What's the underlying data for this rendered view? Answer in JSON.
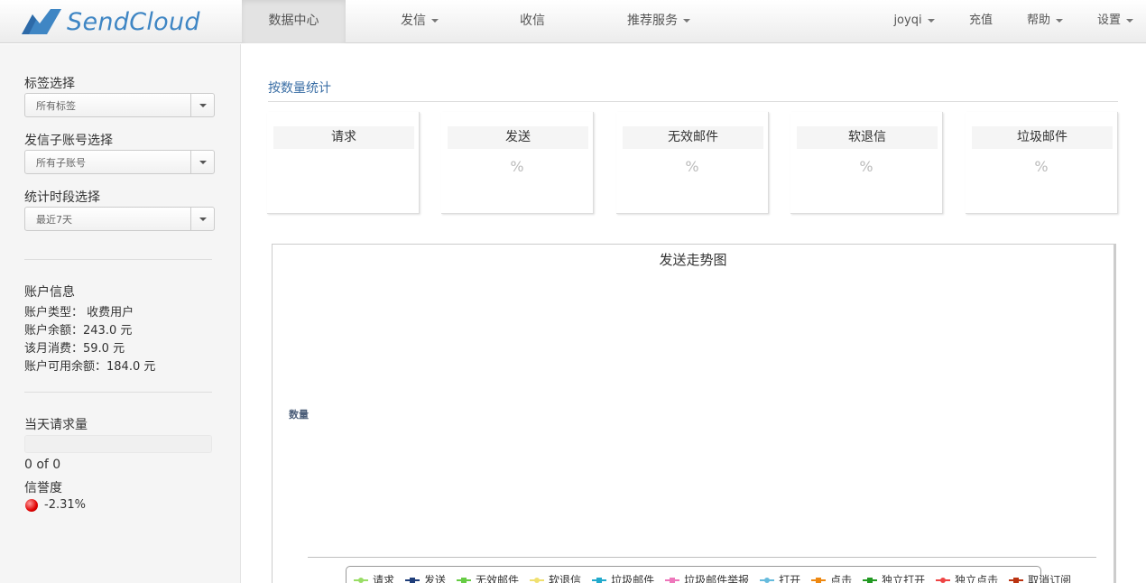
{
  "brand": {
    "name": "SendCloud",
    "color": "#3f86c4"
  },
  "nav": {
    "items": [
      {
        "label": "数据中心",
        "active": true
      },
      {
        "label": "发信",
        "dropdown": true
      },
      {
        "label": "收信"
      },
      {
        "label": "推荐服务",
        "dropdown": true
      }
    ],
    "right": [
      {
        "label": "joyqi",
        "dropdown": true
      },
      {
        "label": "充值"
      },
      {
        "label": "帮助",
        "dropdown": true
      },
      {
        "label": "设置",
        "dropdown": true
      }
    ]
  },
  "sidebar": {
    "tag_select": {
      "label": "标签选择",
      "value": "所有标签"
    },
    "subaccount_select": {
      "label": "发信子账号选择",
      "value": "所有子账号"
    },
    "period_select": {
      "label": "统计时段选择",
      "value": "最近7天"
    },
    "account": {
      "title": "账户信息",
      "type": "账户类型： 收费用户",
      "balance": "账户余额：243.0 元",
      "month_spend": "该月消费：59.0 元",
      "available": "账户可用余额：184.0 元"
    },
    "daily": {
      "title": "当天请求量",
      "progress": 0,
      "count": "0 of 0",
      "reputation_label": "信誉度",
      "reputation_value": "-2.31%",
      "reputation_color": "#e00000"
    }
  },
  "main": {
    "section_title": "按数量统计",
    "stats": [
      {
        "label": "请求",
        "value": ""
      },
      {
        "label": "发送",
        "value": "%"
      },
      {
        "label": "无效邮件",
        "value": "%"
      },
      {
        "label": "软退信",
        "value": "%"
      },
      {
        "label": "垃圾邮件",
        "value": "%"
      }
    ]
  },
  "chart_data": {
    "type": "line",
    "title": "发送走势图",
    "ylabel": "数量",
    "xlabel": "",
    "categories": [],
    "legend_placement": "bottom",
    "series": [
      {
        "name": "请求",
        "values": [],
        "color": "#99dd66"
      },
      {
        "name": "发送",
        "values": [],
        "color": "#1f3e7a"
      },
      {
        "name": "无效邮件",
        "values": [],
        "color": "#66cc44"
      },
      {
        "name": "软退信",
        "values": [],
        "color": "#f0e070"
      },
      {
        "name": "垃圾邮件",
        "values": [],
        "color": "#22aacc"
      },
      {
        "name": "垃圾邮件举报",
        "values": [],
        "color": "#ee77bb"
      },
      {
        "name": "打开",
        "values": [],
        "color": "#66bbdd"
      },
      {
        "name": "点击",
        "values": [],
        "color": "#ee8811"
      },
      {
        "name": "独立打开",
        "values": [],
        "color": "#229922"
      },
      {
        "name": "独立点击",
        "values": [],
        "color": "#ee4444"
      },
      {
        "name": "取消订阅",
        "values": [],
        "color": "#bb3311"
      }
    ]
  }
}
